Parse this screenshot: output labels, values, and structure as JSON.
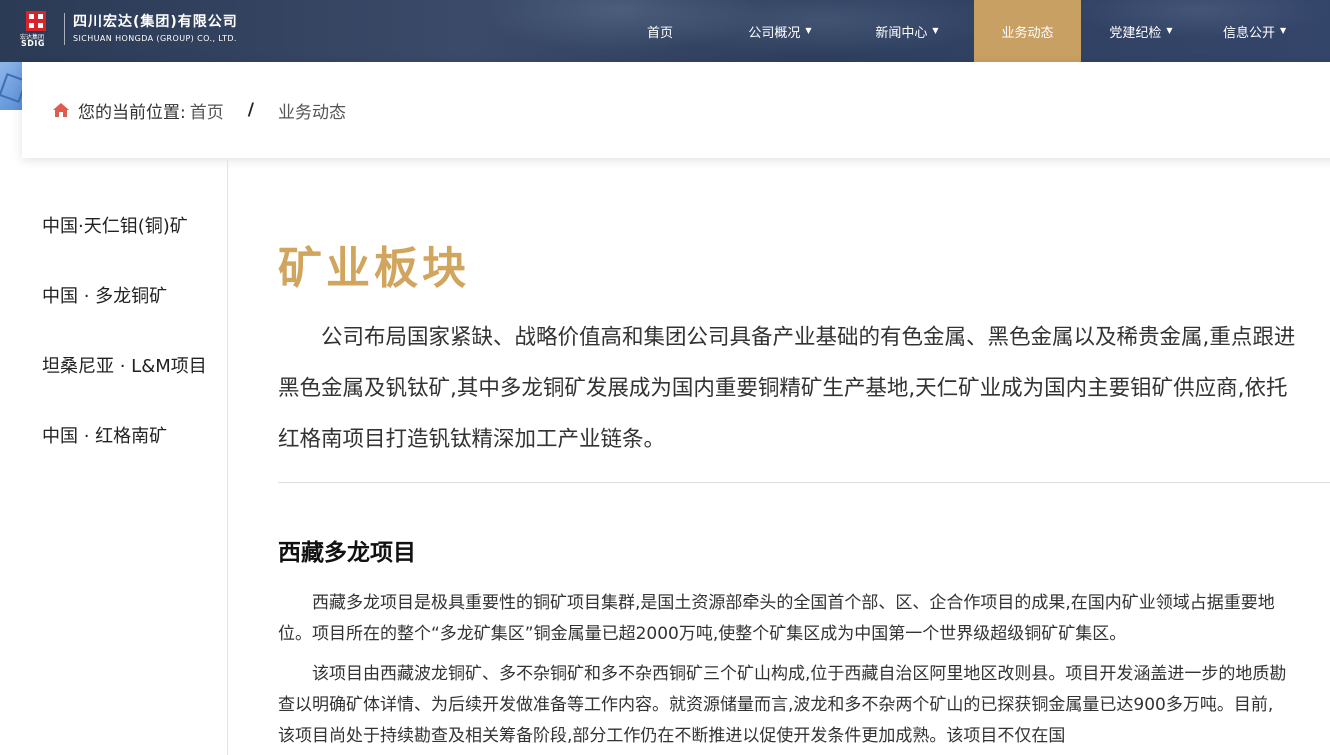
{
  "header": {
    "logo_cn": "四川宏达(集团)有限公司",
    "logo_en": "SICHUAN HONGDA (GROUP) CO., LTD.",
    "logo_mark_cn": "宏达集团",
    "logo_mark_en": "SDIG",
    "nav": [
      {
        "label": "首页",
        "dropdown": false,
        "active": false
      },
      {
        "label": "公司概况",
        "dropdown": true,
        "active": false
      },
      {
        "label": "新闻中心",
        "dropdown": true,
        "active": false
      },
      {
        "label": "业务动态",
        "dropdown": false,
        "active": true
      },
      {
        "label": "党建纪检",
        "dropdown": true,
        "active": false
      },
      {
        "label": "信息公开",
        "dropdown": true,
        "active": false
      }
    ],
    "colors": {
      "active_bg": "#c9a063",
      "header_bg": "#2f3f5e"
    }
  },
  "breadcrumb": {
    "label": "您的当前位置:",
    "home": "首页",
    "separator": "/",
    "current": "业务动态"
  },
  "sidebar": {
    "items": [
      {
        "label": "中国·天仁钼(铜)矿"
      },
      {
        "label": "中国 · 多龙铜矿"
      },
      {
        "label": "坦桑尼亚 · L&M项目"
      },
      {
        "label": "中国 · 红格南矿"
      }
    ]
  },
  "main": {
    "title": "矿业板块",
    "title_color": "#d1a55e",
    "intro": "公司布局国家紧缺、战略价值高和集团公司具备产业基础的有色金属、黑色金属以及稀贵金属,重点跟进黑色金属及钒钛矿,其中多龙铜矿发展成为国内重要铜精矿生产基地,天仁矿业成为国内主要钼矿供应商,依托红格南项目打造钒钛精深加工产业链条。",
    "subtitle": "西藏多龙项目",
    "paragraphs": [
      "西藏多龙项目是极具重要性的铜矿项目集群,是国土资源部牵头的全国首个部、区、企合作项目的成果,在国内矿业领域占据重要地位。项目所在的整个“多龙矿集区”铜金属量已超2000万吨,使整个矿集区成为中国第一个世界级超级铜矿矿集区。",
      "该项目由西藏波龙铜矿、多不杂铜矿和多不杂西铜矿三个矿山构成,位于西藏自治区阿里地区改则县。项目开发涵盖进一步的地质勘查以明确矿体详情、为后续开发做准备等工作内容。就资源储量而言,波龙和多不杂两个矿山的已探获铜金属量已达900多万吨。目前,该项目尚处于持续勘查及相关筹备阶段,部分工作仍在不断推进以促使开发条件更加成熟。该项目不仅在国"
    ]
  }
}
